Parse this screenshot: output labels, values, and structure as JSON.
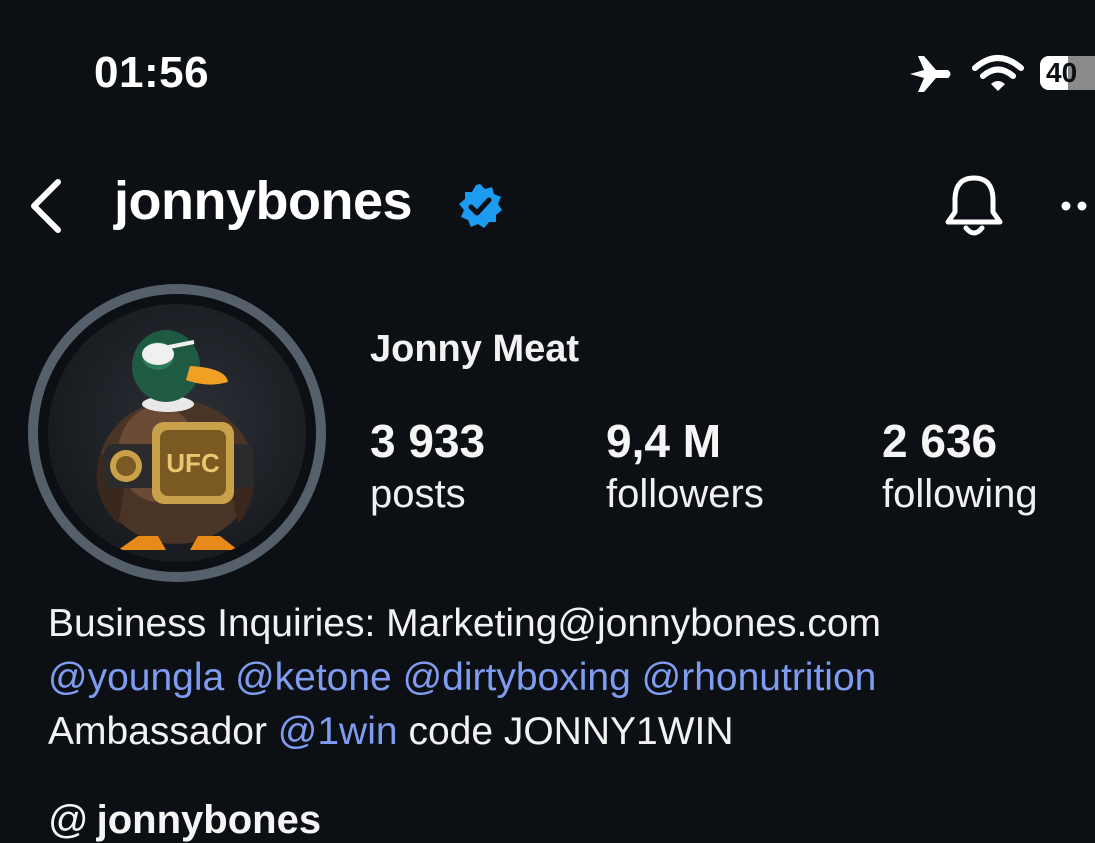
{
  "status_bar": {
    "time": "01:56",
    "battery": "40",
    "battery_level": 0.4,
    "icons": [
      "airplane-icon",
      "wifi-icon"
    ]
  },
  "header": {
    "username": "jonnybones",
    "icons": [
      "chevron-left-icon",
      "verified-badge-icon",
      "bell-icon",
      "more-icon"
    ],
    "accent_color": "#1d9bf0"
  },
  "profile": {
    "display_name": "Jonny Meat",
    "avatar": "duck-with-ufc-belt-avatar",
    "stats": {
      "posts": {
        "value": "3 933",
        "label": "posts"
      },
      "followers": {
        "value": "9,4 M",
        "label": "followers"
      },
      "following": {
        "value": "2 636",
        "label": "following"
      }
    }
  },
  "bio": {
    "line1": "Business Inquiries: Marketing@jonnybones.com",
    "mentions": [
      "@youngla",
      "@ketone",
      "@dirtyboxing",
      "@rhonutrition"
    ],
    "line3_prefix": "Ambassador",
    "line3_mention": "@1win",
    "line3_suffix": "code JONNY1WIN",
    "mention_color": "#7f9cf0"
  },
  "threads": {
    "icon": "threads-icon",
    "handle": "jonnybones"
  }
}
